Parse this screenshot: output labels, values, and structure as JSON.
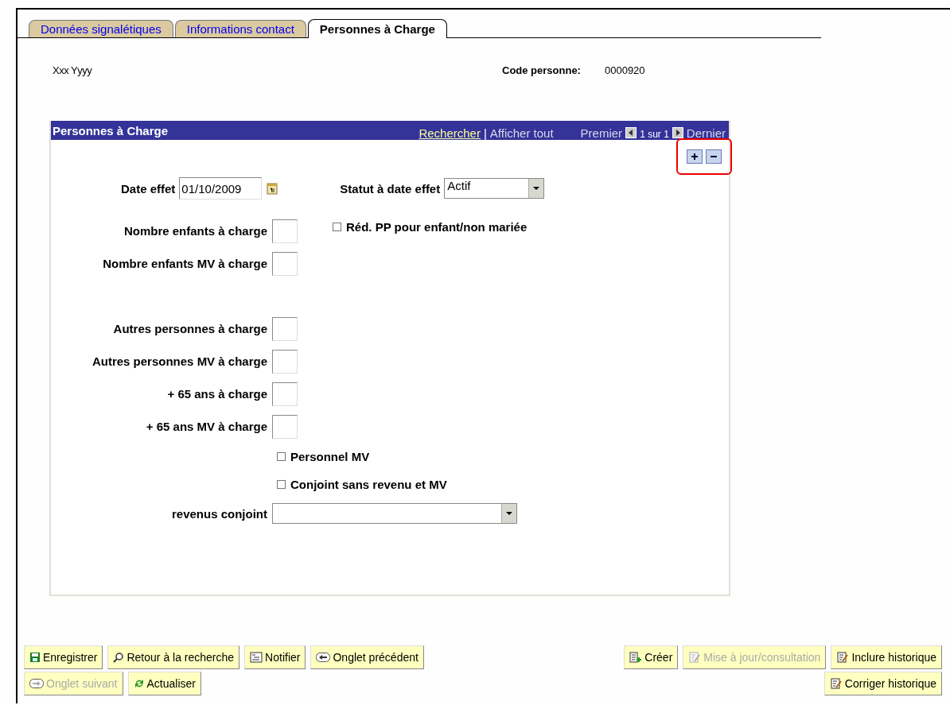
{
  "tabs": [
    {
      "label": "Données signalétiques",
      "selected": false
    },
    {
      "label": "Informations contact",
      "selected": false
    },
    {
      "label": "Personnes à Charge",
      "selected": true
    }
  ],
  "person": {
    "name": "Xxx Yyyy",
    "code_label": "Code personne:",
    "code_value": "0000920"
  },
  "panel": {
    "title": "Personnes à Charge",
    "search_link": "Rechercher",
    "separator": "|",
    "show_all": "Afficher tout",
    "first": "Premier",
    "position": "1 sur 1",
    "last": "Dernier"
  },
  "date_effet": {
    "label": "Date effet",
    "value": "01/10/2009"
  },
  "statut": {
    "label": "Statut à date effet",
    "value": "Actif"
  },
  "reduction": {
    "label": "Réd. PP pour enfant/non mariée",
    "checked": false
  },
  "count_groups": [
    [
      {
        "label": "Nombre enfants à charge"
      },
      {
        "label": "Nombre enfants MV à charge"
      }
    ],
    [
      {
        "label": "Autres personnes à charge"
      },
      {
        "label": "Autres personnes MV à charge"
      },
      {
        "label": "+ 65 ans à charge"
      },
      {
        "label": "+ 65 ans MV à charge"
      }
    ]
  ],
  "checkboxes": [
    {
      "label": "Personnel MV",
      "checked": false
    },
    {
      "label": "Conjoint sans revenu et MV",
      "checked": false
    }
  ],
  "revenus": {
    "label": "revenus conjoint"
  },
  "buttons_left": [
    [
      {
        "label": "Enregistrer",
        "kind": "save",
        "disabled": false
      },
      {
        "label": "Retour à la recherche",
        "kind": "search",
        "disabled": false
      },
      {
        "label": "Notifier",
        "kind": "notify",
        "disabled": false
      },
      {
        "label": "Onglet précédent",
        "kind": "prev",
        "disabled": false
      }
    ],
    [
      {
        "label": "Onglet suivant",
        "kind": "next",
        "disabled": true
      },
      {
        "label": "Actualiser",
        "kind": "refresh",
        "disabled": false
      }
    ]
  ],
  "buttons_right": [
    [
      {
        "label": "Créer",
        "kind": "add",
        "disabled": false
      },
      {
        "label": "Mise à jour/consultation",
        "kind": "edit",
        "disabled": true
      },
      {
        "label": "Inclure historique",
        "kind": "history",
        "disabled": false
      }
    ],
    [
      {
        "label": "Corriger historique",
        "kind": "correct",
        "disabled": false
      }
    ]
  ]
}
